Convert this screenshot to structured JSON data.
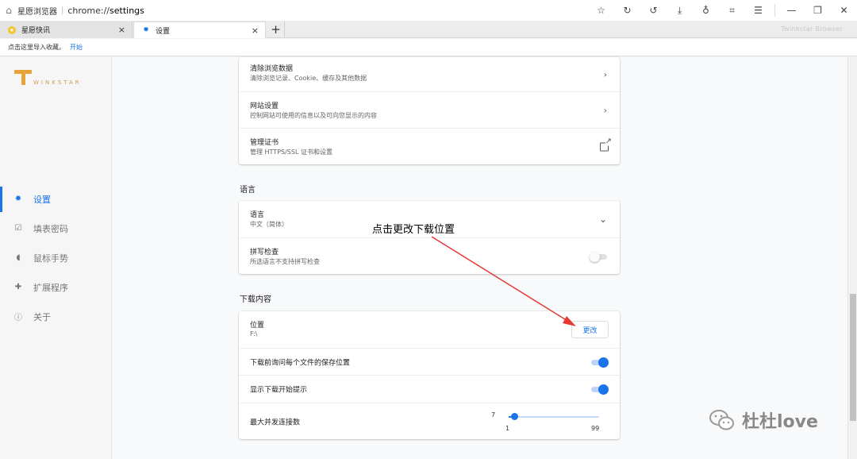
{
  "titlebar": {
    "app_name": "星愿浏览器",
    "separator": "|",
    "url_prefix": "chrome://",
    "url_page": "settings",
    "home_icon": "home-icon",
    "tools": [
      "star-icon",
      "refresh-icon",
      "undo-icon",
      "download-icon",
      "user-icon",
      "crop-icon",
      "menu-icon"
    ],
    "window_controls": [
      "minimize-icon",
      "restore-icon",
      "close-icon"
    ]
  },
  "tabs": [
    {
      "label": "星愿快讯",
      "close": "×"
    },
    {
      "label": "设置",
      "close": "×"
    }
  ],
  "new_tab": "+",
  "brand_text": "Twinkstar Browser",
  "bookmarks_bar": {
    "text": "点击这里导入收藏。",
    "link": "开始"
  },
  "sidebar": {
    "logo_word": "WINKSTAR",
    "items": [
      {
        "label": "设置",
        "icon": "gear-icon",
        "active": true
      },
      {
        "label": "填表密码",
        "icon": "form-icon",
        "active": false
      },
      {
        "label": "鼠标手势",
        "icon": "mouse-icon",
        "active": false
      },
      {
        "label": "扩展程序",
        "icon": "puzzle-icon",
        "active": false
      },
      {
        "label": "关于",
        "icon": "info-icon",
        "active": false
      }
    ]
  },
  "privacy_card": [
    {
      "title": "清除浏览数据",
      "desc": "清除浏览记录、Cookie、缓存及其他数据",
      "action": "›"
    },
    {
      "title": "网站设置",
      "desc": "控制网站可使用的信息以及可向您显示的内容",
      "action": "›"
    },
    {
      "title": "管理证书",
      "desc": "管理 HTTPS/SSL 证书和设置",
      "action": "external-link-icon"
    }
  ],
  "language_section": {
    "heading": "语言",
    "language_row": {
      "title": "语言",
      "value": "中文（简体）",
      "chevron": "⌄"
    },
    "spellcheck_row": {
      "title": "拼写检查",
      "desc": "所选语言不支持拼写检查",
      "enabled": false
    }
  },
  "downloads_section": {
    "heading": "下载内容",
    "location_row": {
      "title": "位置",
      "value": "F:\\",
      "button": "更改"
    },
    "ask_row": {
      "label": "下载前询问每个文件的保存位置",
      "enabled": true
    },
    "prompt_row": {
      "label": "显示下载开始提示",
      "enabled": true
    },
    "connections_row": {
      "label": "最大并发连接数",
      "current": "7",
      "min": "1",
      "max": "99",
      "level": 0.06
    }
  },
  "annotation": {
    "text": "点击更改下载位置",
    "color": "#e53935"
  },
  "watermark": {
    "text": "杜杜love"
  },
  "colors": {
    "accent": "#1a73e8",
    "logo": "#e8a23a",
    "annotation": "#e53935"
  }
}
